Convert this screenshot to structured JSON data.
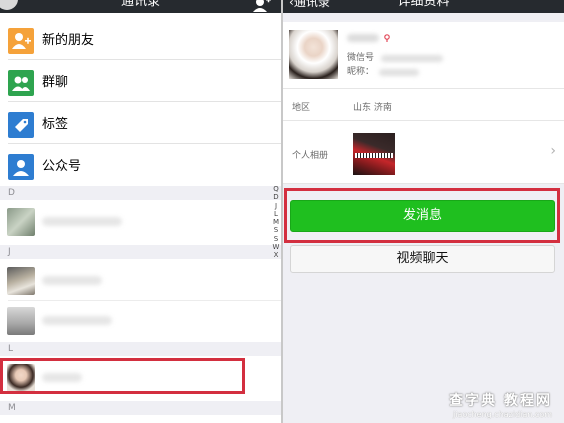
{
  "left": {
    "title": "通讯录",
    "menu": [
      {
        "label": "新的朋友",
        "icon": "new-friend-icon",
        "color": "#f5a23a"
      },
      {
        "label": "群聊",
        "icon": "group-chat-icon",
        "color": "#2ea44f"
      },
      {
        "label": "标签",
        "icon": "tag-icon",
        "color": "#2e7dd1"
      },
      {
        "label": "公众号",
        "icon": "official-account-icon",
        "color": "#2e7dd1"
      }
    ],
    "sections": [
      "D",
      "J",
      "L",
      "M"
    ],
    "index": [
      "Q",
      "D",
      "J",
      "L",
      "M",
      "S",
      "S",
      "W",
      "X"
    ]
  },
  "right": {
    "back_label": "通讯录",
    "title": "详细资料",
    "wechat_id_label": "微信号",
    "nickname_label": "昵称：",
    "region_label": "地区",
    "region_value": "山东 济南",
    "album_label": "个人相册",
    "send_message": "发消息",
    "video_chat": "视频聊天"
  },
  "watermark": {
    "line1": "查字典 教程网",
    "line2": "jiaocheng.chazidian.com"
  },
  "colors": {
    "highlight": "#d32f3f",
    "send_button": "#1fbf1f",
    "nav_bar": "#262a2f"
  }
}
